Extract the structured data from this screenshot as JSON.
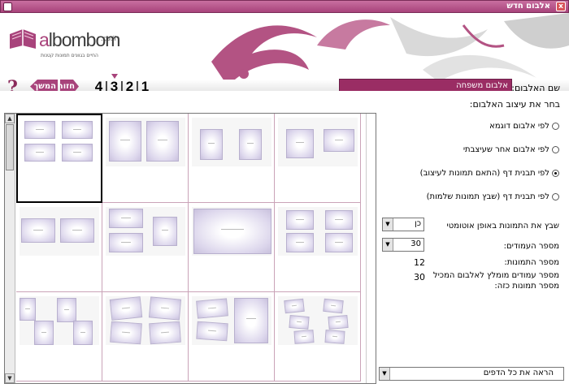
{
  "window": {
    "title": "אלבום חדש",
    "close_label": "x"
  },
  "logo": {
    "brand_prefix": "a",
    "brand_rest": "lbombom",
    "tld": ".co.il",
    "tagline": "החיים בגוונים תמונות קטנות"
  },
  "toolbar": {
    "help_label": "?",
    "next_label": "המשך",
    "back_label": "חזור",
    "steps": [
      "4",
      "3",
      "2",
      "1"
    ],
    "current_step": "3"
  },
  "album": {
    "name_label": "שם האלבום:",
    "name_value": "אלבום משפחה"
  },
  "design": {
    "heading": "בחר את עיצוב האלבום:",
    "options": [
      {
        "label": "לפי אלבום דוגמא",
        "selected": false
      },
      {
        "label": "לפי אלבום אחר שעיצבתי",
        "selected": false
      },
      {
        "label": "לפי תבנית דף (התאם תמונות לעיצוב)",
        "selected": true
      },
      {
        "label": "לפי תבנית דף (שבץ תמונות שלמות)",
        "selected": false
      }
    ]
  },
  "settings": {
    "auto_place_label": "שבץ את התמונות באופן אוטומטי",
    "auto_place_value": "כן",
    "pages_label": "מספר העמודים:",
    "pages_value": "30",
    "photos_label": "מספר התמונות:",
    "photos_value": "12",
    "recommended_label": "מספר עמודים מומלץ לאלבום המכיל מספר תמונות כזה:",
    "recommended_value": "30",
    "filter_value": "הראה את כל הדפים"
  },
  "icons": {
    "dropdown": "triangle-down-icon",
    "scroll_up": "triangle-up-icon",
    "scroll_down": "triangle-down-icon"
  },
  "colors": {
    "brand": "#a8437b",
    "input_bg": "#9a2d64"
  }
}
